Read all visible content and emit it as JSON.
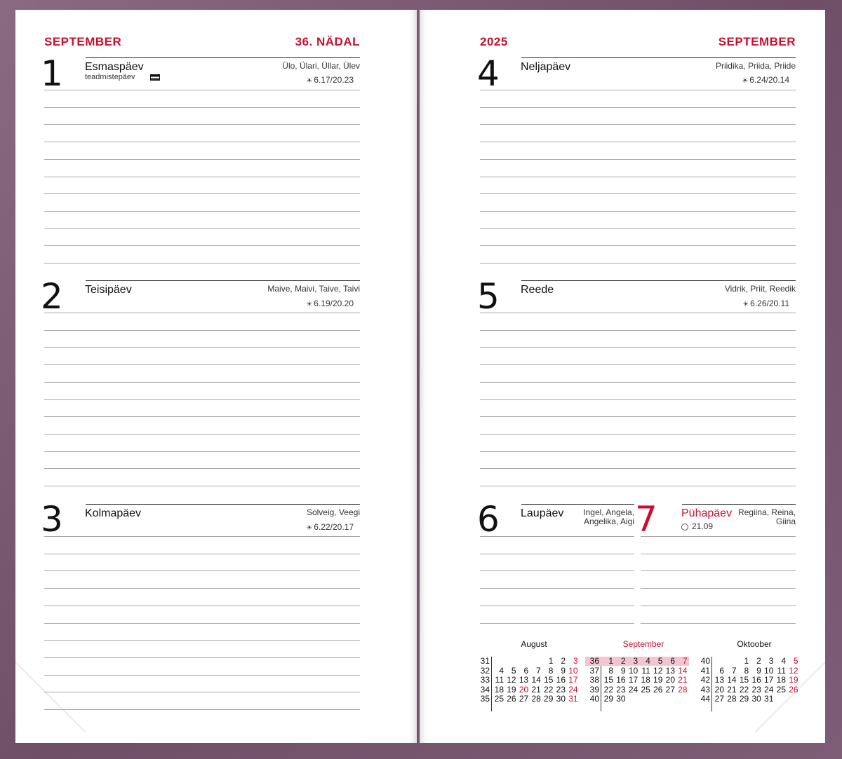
{
  "left_page": {
    "month": "SEPTEMBER",
    "week": "36. NÄDAL",
    "days": [
      {
        "num": "1",
        "name": "Esmaspäev",
        "holiday": "teadmistepäev",
        "namedays": "Ülo, Ülari, Üllar, Ülev",
        "sun": "6.17/20.23"
      },
      {
        "num": "2",
        "name": "Teisipäev",
        "namedays": "Maive, Maivi, Taive, Taivi",
        "sun": "6.19/20.20"
      },
      {
        "num": "3",
        "name": "Kolmapäev",
        "namedays": "Solveig, Veegi",
        "sun": "6.22/20.17"
      }
    ]
  },
  "right_page": {
    "year": "2025",
    "month": "SEPTEMBER",
    "days": [
      {
        "num": "4",
        "name": "Neljapäev",
        "namedays": "Priidika, Priida, Priide",
        "sun": "6.24/20.14"
      },
      {
        "num": "5",
        "name": "Reede",
        "namedays": "Vidrik, Priit, Reedik",
        "sun": "6.26/20.11"
      },
      {
        "num": "6",
        "name": "Laupäev",
        "namedays_1": "Ingel, Angela,",
        "namedays_2": "Angelika, Aigi"
      },
      {
        "num": "7",
        "name": "Pühapäev",
        "namedays_1": "Regiina, Reina,",
        "namedays_2": "Giina",
        "moon": "21.09"
      }
    ]
  },
  "mini_calendars": [
    {
      "title": "August",
      "weeks": [
        "31",
        "32",
        "33",
        "34",
        "35"
      ],
      "rows": [
        [
          "",
          "",
          "",
          "",
          "1",
          "2",
          "3"
        ],
        [
          "4",
          "5",
          "6",
          "7",
          "8",
          "9",
          "10"
        ],
        [
          "11",
          "12",
          "13",
          "14",
          "15",
          "16",
          "17"
        ],
        [
          "18",
          "19",
          "20",
          "21",
          "22",
          "23",
          "24"
        ],
        [
          "25",
          "26",
          "27",
          "28",
          "29",
          "30",
          "31"
        ]
      ],
      "red_cells": [
        [
          0,
          6
        ],
        [
          1,
          6
        ],
        [
          2,
          6
        ],
        [
          3,
          2
        ],
        [
          3,
          6
        ],
        [
          4,
          6
        ]
      ]
    },
    {
      "title": "September",
      "weeks": [
        "36",
        "37",
        "38",
        "39",
        "40"
      ],
      "rows": [
        [
          "1",
          "2",
          "3",
          "4",
          "5",
          "6",
          "7"
        ],
        [
          "8",
          "9",
          "10",
          "11",
          "12",
          "13",
          "14"
        ],
        [
          "15",
          "16",
          "17",
          "18",
          "19",
          "20",
          "21"
        ],
        [
          "22",
          "23",
          "24",
          "25",
          "26",
          "27",
          "28"
        ],
        [
          "29",
          "30",
          "",
          "",
          "",
          "",
          ""
        ]
      ],
      "red_cells": [
        [
          0,
          6
        ],
        [
          1,
          6
        ],
        [
          2,
          6
        ],
        [
          3,
          6
        ]
      ],
      "highlight_row": 0
    },
    {
      "title": "Oktoober",
      "weeks": [
        "40",
        "41",
        "42",
        "43",
        "44"
      ],
      "rows": [
        [
          "",
          "",
          "1",
          "2",
          "3",
          "4",
          "5"
        ],
        [
          "6",
          "7",
          "8",
          "9",
          "10",
          "11",
          "12"
        ],
        [
          "13",
          "14",
          "15",
          "16",
          "17",
          "18",
          "19"
        ],
        [
          "20",
          "21",
          "22",
          "23",
          "24",
          "25",
          "26"
        ],
        [
          "27",
          "28",
          "29",
          "30",
          "31",
          "",
          ""
        ]
      ],
      "red_cells": [
        [
          0,
          6
        ],
        [
          1,
          6
        ],
        [
          2,
          6
        ],
        [
          3,
          6
        ]
      ]
    }
  ],
  "colors": {
    "accent": "#c8102e",
    "cover": "#7a5a72",
    "highlight": "#f5c4d2"
  }
}
